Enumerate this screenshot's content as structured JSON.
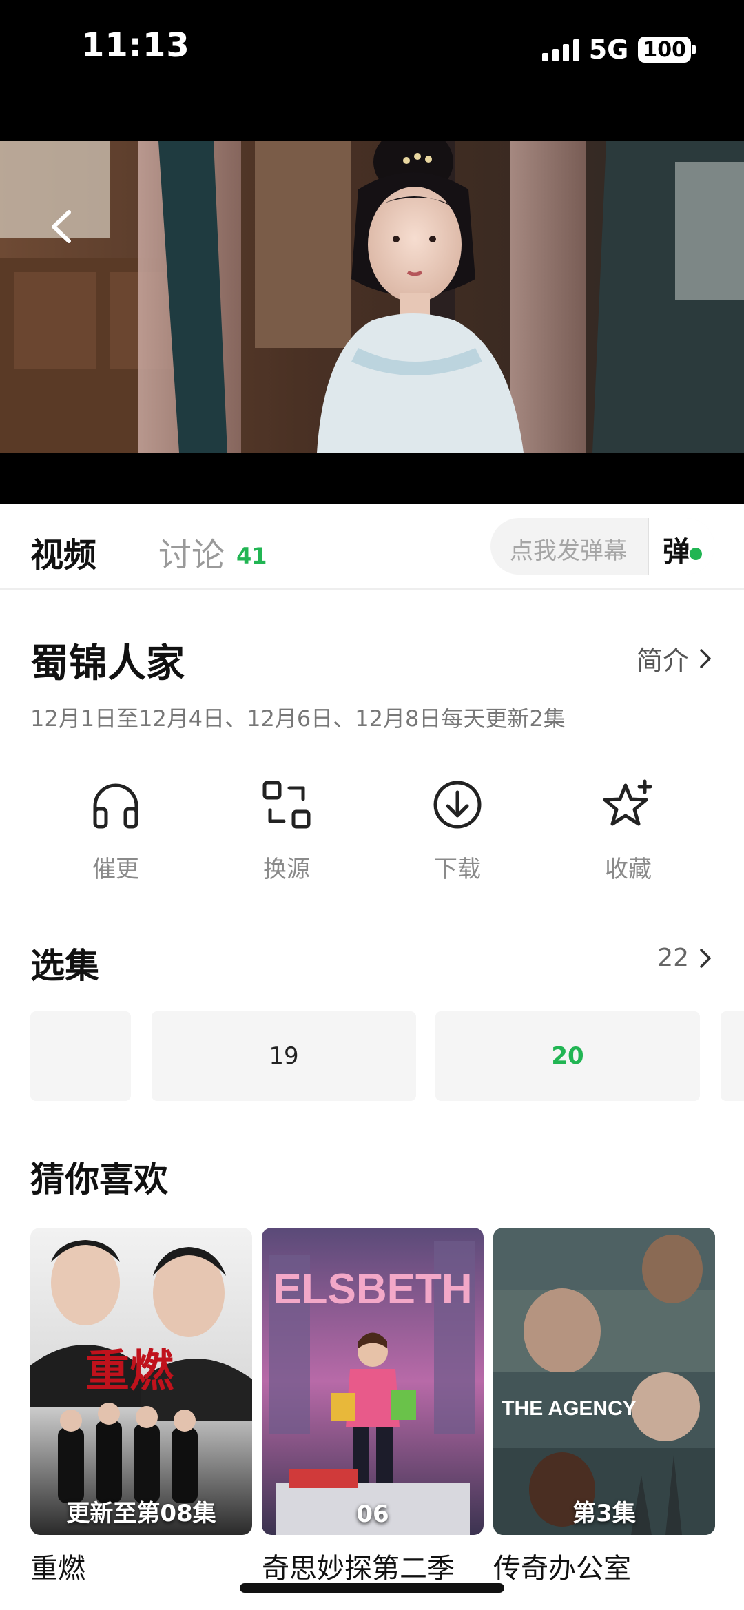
{
  "status_bar": {
    "time": "11:13",
    "network": "5G",
    "battery": "100"
  },
  "tabs": {
    "video": "视频",
    "discussion": "讨论",
    "discussion_count": "41"
  },
  "danmaku": {
    "placeholder": "点我发弹幕",
    "toggle": "弹"
  },
  "show": {
    "title": "蜀锦人家",
    "intro_label": "简介",
    "update_info": "12月1日至12月4日、12月6日、12月8日每天更新2集"
  },
  "actions": [
    {
      "label": "催更",
      "icon": "headphones-icon"
    },
    {
      "label": "换源",
      "icon": "switch-source-icon"
    },
    {
      "label": "下载",
      "icon": "download-icon"
    },
    {
      "label": "收藏",
      "icon": "star-plus-icon"
    }
  ],
  "episodes": {
    "section_title": "选集",
    "total": "22",
    "items": [
      "",
      "19",
      "20"
    ],
    "current": "20"
  },
  "recommendations": {
    "section_title": "猜你喜欢",
    "items": [
      {
        "title": "重燃",
        "badge": "更新至第08集",
        "poster_text": "重燃"
      },
      {
        "title": "奇思妙探第二季",
        "badge": "06",
        "poster_text": "ELSBETH"
      },
      {
        "title": "传奇办公室",
        "badge": "第3集",
        "poster_text": "THE AGENCY"
      }
    ]
  },
  "colors": {
    "accent": "#21b553",
    "muted": "#8a8a8a"
  }
}
